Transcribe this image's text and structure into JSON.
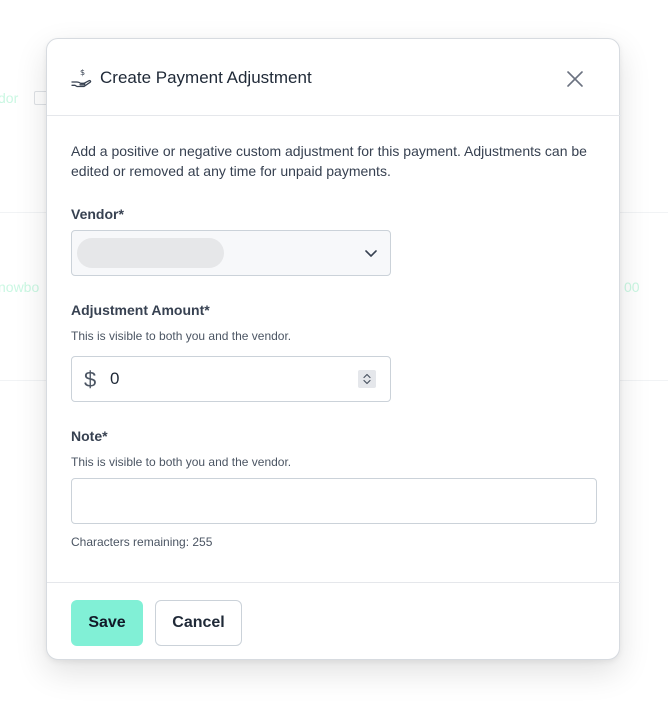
{
  "background": {
    "left_text": "dor",
    "middle_text": "nowbo",
    "right_text": "00"
  },
  "modal": {
    "title": "Create Payment Adjustment",
    "title_icon": "hand-dollar-icon",
    "close_icon": "close-icon",
    "description": "Add a positive or negative custom adjustment for this payment. Adjustments can be edited or removed at any time for unpaid payments.",
    "vendor": {
      "label": "Vendor*",
      "chevron_icon": "chevron-down-icon"
    },
    "amount": {
      "label": "Adjustment Amount*",
      "help": "This is visible to both you and the vendor.",
      "currency_symbol": "$",
      "value": "0"
    },
    "note": {
      "label": "Note*",
      "help": "This is visible to both you and the vendor.",
      "value": "",
      "remaining": "Characters remaining: 255"
    },
    "buttons": {
      "save": "Save",
      "cancel": "Cancel"
    }
  },
  "colors": {
    "accent": "#81f0d6",
    "border": "#cbd2d9"
  }
}
